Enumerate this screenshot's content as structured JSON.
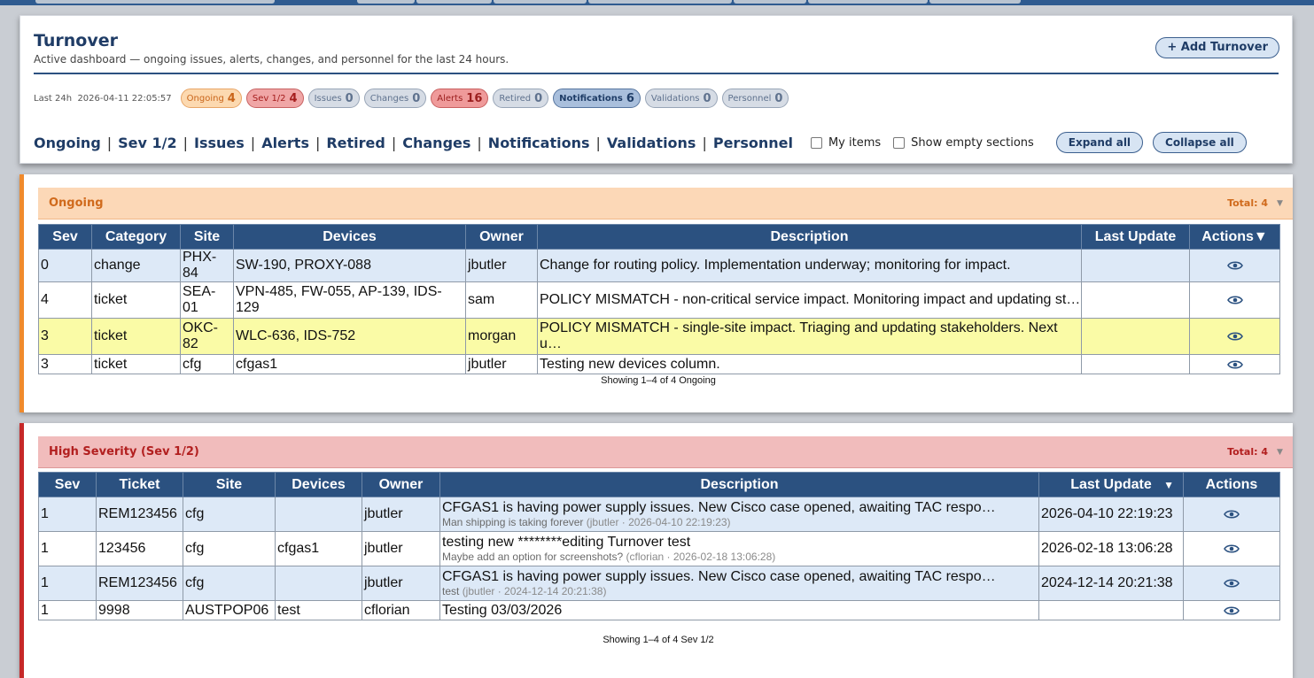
{
  "header": {
    "title": "Turnover",
    "subtitle": "Active dashboard — ongoing issues, alerts, changes, and personnel for the last 24 hours.",
    "add_button": "+ Add Turnover"
  },
  "stats": {
    "window": "Last 24h",
    "timestamp": "2026-04-11 22:05:57",
    "chips": [
      {
        "label": "Ongoing",
        "count": "4"
      },
      {
        "label": "Sev 1/2",
        "count": "4"
      },
      {
        "label": "Issues",
        "count": "0"
      },
      {
        "label": "Changes",
        "count": "0"
      },
      {
        "label": "Alerts",
        "count": "16"
      },
      {
        "label": "Retired",
        "count": "0"
      },
      {
        "label": "Notifications",
        "count": "6"
      },
      {
        "label": "Validations",
        "count": "0"
      },
      {
        "label": "Personnel",
        "count": "0"
      }
    ]
  },
  "nav": {
    "links": [
      "Ongoing",
      "Sev 1/2",
      "Issues",
      "Alerts",
      "Retired",
      "Changes",
      "Notifications",
      "Validations",
      "Personnel"
    ],
    "my_items": "My items",
    "show_empty": "Show empty sections",
    "expand_all": "Expand all",
    "collapse_all": "Collapse all"
  },
  "ongoing": {
    "title": "Ongoing",
    "total": "Total: 4",
    "columns": [
      "Sev",
      "Category",
      "Site",
      "Devices",
      "Owner",
      "Description",
      "Last Update",
      "Actions"
    ],
    "rows": [
      {
        "sev": "0",
        "category": "change",
        "site": "PHX-84",
        "devices": "SW-190, PROXY-088",
        "owner": "jbutler",
        "description": "Change for routing policy. Implementation underway; monitoring for impact.",
        "last_update": ""
      },
      {
        "sev": "4",
        "category": "ticket",
        "site": "SEA-01",
        "devices": "VPN-485, FW-055, AP-139, IDS-129",
        "owner": "sam",
        "description": "POLICY MISMATCH - non-critical service impact. Monitoring impact and updating st…",
        "last_update": ""
      },
      {
        "sev": "3",
        "category": "ticket",
        "site": "OKC-82",
        "devices": "WLC-636, IDS-752",
        "owner": "morgan",
        "description": "POLICY MISMATCH - single-site impact. Triaging and updating stakeholders. Next u…",
        "last_update": ""
      },
      {
        "sev": "3",
        "category": "ticket",
        "site": "cfg",
        "devices": "cfgas1",
        "owner": "jbutler",
        "description": "Testing new devices column.",
        "last_update": ""
      }
    ],
    "footer": "Showing 1–4 of 4 Ongoing"
  },
  "high": {
    "title": "High Severity (Sev 1/2)",
    "total": "Total: 4",
    "columns": [
      "Sev",
      "Ticket",
      "Site",
      "Devices",
      "Owner",
      "Description",
      "Last Update",
      "Actions"
    ],
    "rows": [
      {
        "sev": "1",
        "ticket": "REM123456",
        "site": "cfg",
        "devices": "",
        "owner": "jbutler",
        "description": "CFGAS1 is having power supply issues. New Cisco case opened, awaiting TAC respo…",
        "note": "Man shipping is taking forever",
        "note_meta": "(jbutler · 2026-04-10 22:19:23)",
        "last_update": "2026-04-10 22:19:23"
      },
      {
        "sev": "1",
        "ticket": "123456",
        "site": "cfg",
        "devices": "cfgas1",
        "owner": "jbutler",
        "description": "testing new ********editing Turnover test",
        "note": "Maybe add an option for screenshots?",
        "note_meta": "(cflorian · 2026-02-18 13:06:28)",
        "last_update": "2026-02-18 13:06:28"
      },
      {
        "sev": "1",
        "ticket": "REM123456",
        "site": "cfg",
        "devices": "",
        "owner": "jbutler",
        "description": "CFGAS1 is having power supply issues. New Cisco case opened, awaiting TAC respo…",
        "note": "test",
        "note_meta": "(jbutler · 2024-12-14 20:21:38)",
        "last_update": "2024-12-14 20:21:38"
      },
      {
        "sev": "1",
        "ticket": "9998",
        "site": "AUSTPOP06",
        "devices": "test",
        "owner": "cflorian",
        "description": "Testing 03/03/2026",
        "note": "",
        "note_meta": "",
        "last_update": ""
      }
    ],
    "footer": "Showing 1–4 of 4 Sev 1/2"
  },
  "colors": {
    "navy": "#2b5180",
    "ongoing_accent": "#f08a2c",
    "high_accent": "#c62828"
  },
  "icons": {
    "view": "eye-icon",
    "sort": "sort-down-icon",
    "collapse": "chevron-down-icon"
  }
}
